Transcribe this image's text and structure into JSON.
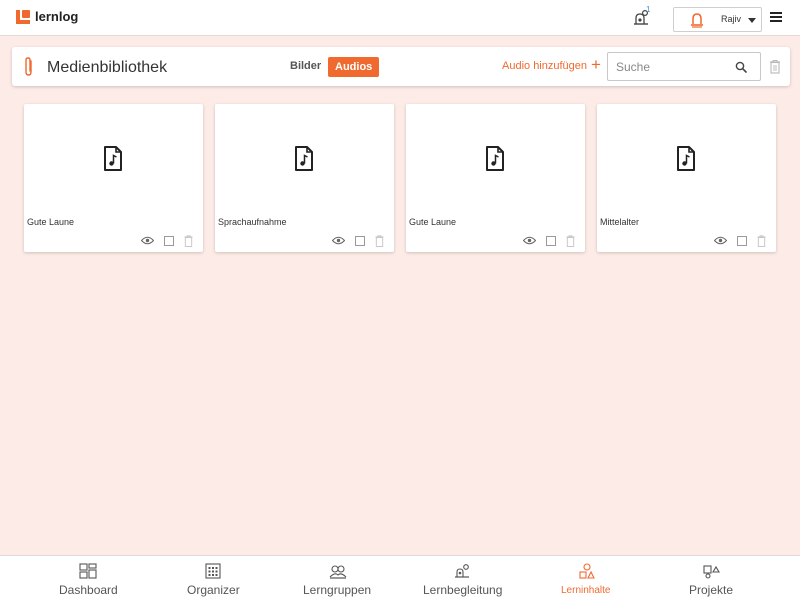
{
  "app": {
    "logo_text": "lernlog"
  },
  "header": {
    "notification_count": "1",
    "user_name": "Rajiv"
  },
  "library": {
    "title": "Medienbibliothek",
    "tabs": [
      {
        "label": "Bilder",
        "active": false
      },
      {
        "label": "Audios",
        "active": true
      }
    ],
    "add_label": "Audio hinzufügen",
    "add_symbol": "+",
    "search_placeholder": "Suche"
  },
  "cards": [
    {
      "title": "Gute Laune",
      "icon": "music-file-icon"
    },
    {
      "title": "Sprachaufnahme",
      "icon": "music-file-icon"
    },
    {
      "title": "Gute Laune",
      "icon": "music-file-icon"
    },
    {
      "title": "Mittelalter",
      "icon": "music-file-icon"
    }
  ],
  "nav": {
    "items": [
      {
        "label": "Dashboard",
        "icon": "dashboard-icon"
      },
      {
        "label": "Organizer",
        "icon": "organizer-icon"
      },
      {
        "label": "Lerngruppen",
        "icon": "groups-icon"
      },
      {
        "label": "Lernbegleitung",
        "icon": "mentoring-icon"
      },
      {
        "label": "Lerninhalte",
        "icon": "content-icon",
        "active": true
      },
      {
        "label": "Projekte",
        "icon": "projects-icon"
      }
    ]
  },
  "colors": {
    "accent": "#f0692f",
    "background": "#fcebe6"
  }
}
